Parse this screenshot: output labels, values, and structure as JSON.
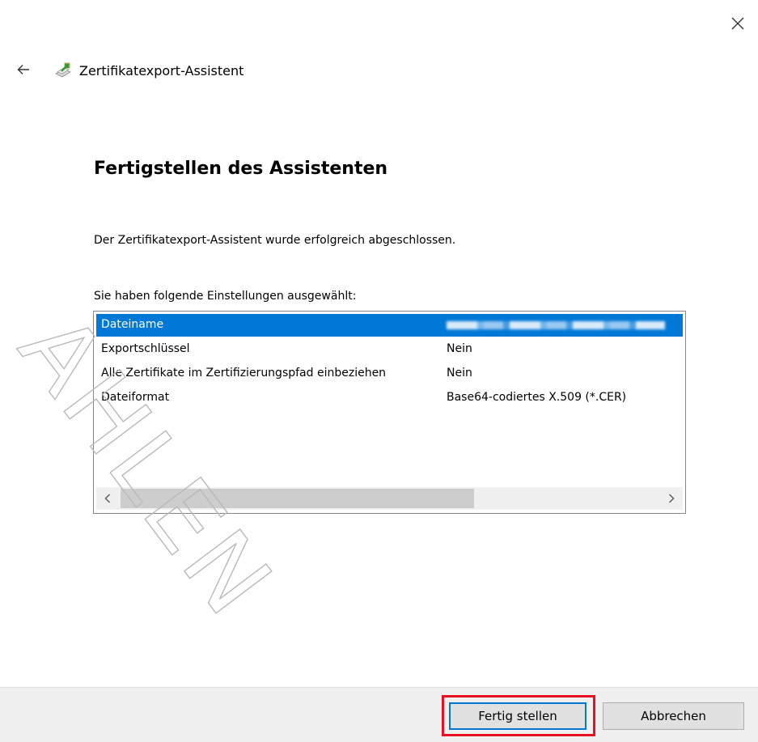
{
  "window": {
    "title": "Zertifikatexport-Assistent",
    "close_icon": "close-icon",
    "back_icon": "back-arrow-icon",
    "app_icon": "certificate-wizard-icon"
  },
  "page": {
    "heading": "Fertigstellen des Assistenten",
    "description": "Der Zertifikatexport-Assistent wurde erfolgreich abgeschlossen.",
    "list_label": "Sie haben folgende Einstellungen ausgewählt:"
  },
  "settings": [
    {
      "key": "Dateiname",
      "value": ""
    },
    {
      "key": "Exportschlüssel",
      "value": "Nein"
    },
    {
      "key": "Alle Zertifikate im Zertifizierungspfad einbeziehen",
      "value": "Nein"
    },
    {
      "key": "Dateiformat",
      "value": "Base64-codiertes X.509 (*.CER)"
    }
  ],
  "buttons": {
    "finish": "Fertig stellen",
    "cancel": "Abbrechen"
  },
  "watermark": "AHLEN",
  "colors": {
    "selection": "#0078d7",
    "highlight_frame": "#e81123",
    "footer_bg": "#f0f0f0"
  }
}
